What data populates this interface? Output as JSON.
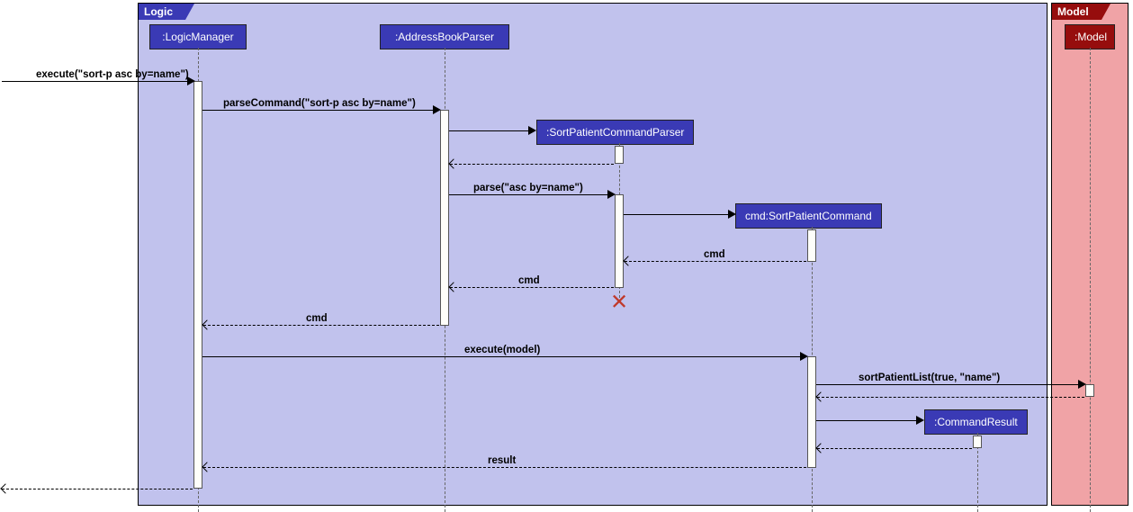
{
  "frames": {
    "logic": "Logic",
    "model": "Model"
  },
  "participants": {
    "logicManager": ":LogicManager",
    "addressBookParser": ":AddressBookParser",
    "sortParser": ":SortPatientCommandParser",
    "sortCmd": "cmd:SortPatientCommand",
    "model": ":Model",
    "commandResult": ":CommandResult"
  },
  "messages": {
    "execute1": "execute(\"sort-p asc by=name\")",
    "parseCommand": "parseCommand(\"sort-p asc by=name\")",
    "parse": "parse(\"asc by=name\")",
    "cmd1": "cmd",
    "cmd2": "cmd",
    "cmd3": "cmd",
    "executeModel": "execute(model)",
    "sortList": "sortPatientList(true, \"name\")",
    "result": "result"
  }
}
